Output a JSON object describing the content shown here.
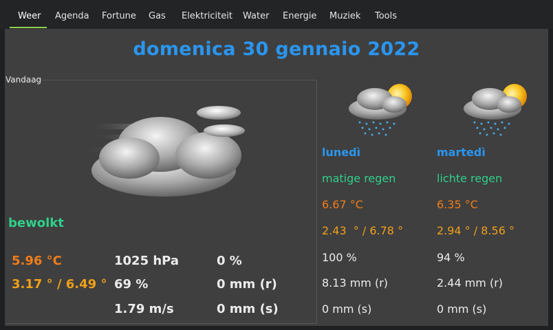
{
  "tabs": [
    {
      "label": "Weer",
      "active": true
    },
    {
      "label": "Agenda"
    },
    {
      "label": "Fortune"
    },
    {
      "label": "Gas"
    },
    {
      "label": "Elektriciteit"
    },
    {
      "label": "Water"
    },
    {
      "label": "Energie"
    },
    {
      "label": "Muziek"
    },
    {
      "label": "Tools"
    }
  ],
  "date": "domenica 30 gennaio 2022",
  "today": {
    "group_label": "Vandaag",
    "icon": "cloudy-icon",
    "description": "bewolkt",
    "temperature": "5.96 °C",
    "minmax": "3.17 ° / 6.49 °",
    "pressure": "1025 hPa",
    "humidity": "69 %",
    "wind": "1.79 m/s",
    "clouds": "0 %",
    "rain": "0 mm (r)",
    "snow": "0 mm (s)"
  },
  "forecast": [
    {
      "icon": "rain-sun-icon",
      "day": "lunedì",
      "description": "matige regen",
      "temperature": "6.67 °C",
      "minmax": "2.43  ° / 6.78 °",
      "humidity": "100 %",
      "rain": "8.13 mm (r)",
      "snow": "0 mm (s)"
    },
    {
      "icon": "rain-sun-icon",
      "day": "martedì",
      "description": "lichte regen",
      "temperature": "6.35 °C",
      "minmax": "2.94 ° / 8.56 °",
      "humidity": "94 %",
      "rain": "2.44 mm (r)",
      "snow": "0 mm (s)"
    }
  ],
  "colors": {
    "accent_tab": "#8fd14a",
    "title_blue": "#2a96f0",
    "desc_green": "#2fd08a",
    "temp_orange": "#f07d1a",
    "range_amber": "#f0a01a"
  }
}
